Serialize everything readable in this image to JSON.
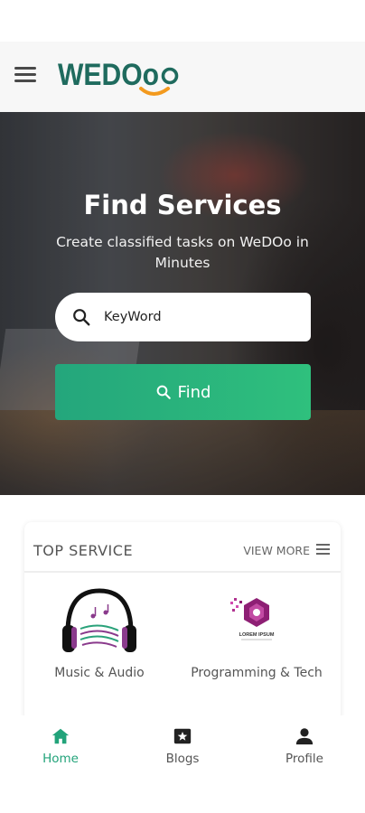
{
  "header": {
    "logo_text": "WEDOo"
  },
  "hero": {
    "title": "Find Services",
    "subtitle": "Create classified tasks on WeDOo in Minutes"
  },
  "search": {
    "value": "KeyWord"
  },
  "find_button": {
    "label": "Find"
  },
  "top_service": {
    "title": "TOP SERVICE",
    "view_more": "VIEW MORE",
    "items": [
      {
        "label": "Music & Audio",
        "icon": "headphones-icon"
      },
      {
        "label": "Programming & Tech",
        "icon": "lorem-ipsum-logo-icon",
        "icon_text": "LOREM IPSUM"
      }
    ]
  },
  "bottom_nav": {
    "items": [
      {
        "label": "Home",
        "icon": "home-icon",
        "active": true
      },
      {
        "label": "Blogs",
        "icon": "blogs-icon",
        "active": false
      },
      {
        "label": "Profile",
        "icon": "profile-icon",
        "active": false
      }
    ]
  },
  "colors": {
    "brand_teal": "#1f6b5e",
    "brand_orange": "#f39a1e",
    "accent_green": "#22a37a",
    "text_dark": "#333333"
  }
}
